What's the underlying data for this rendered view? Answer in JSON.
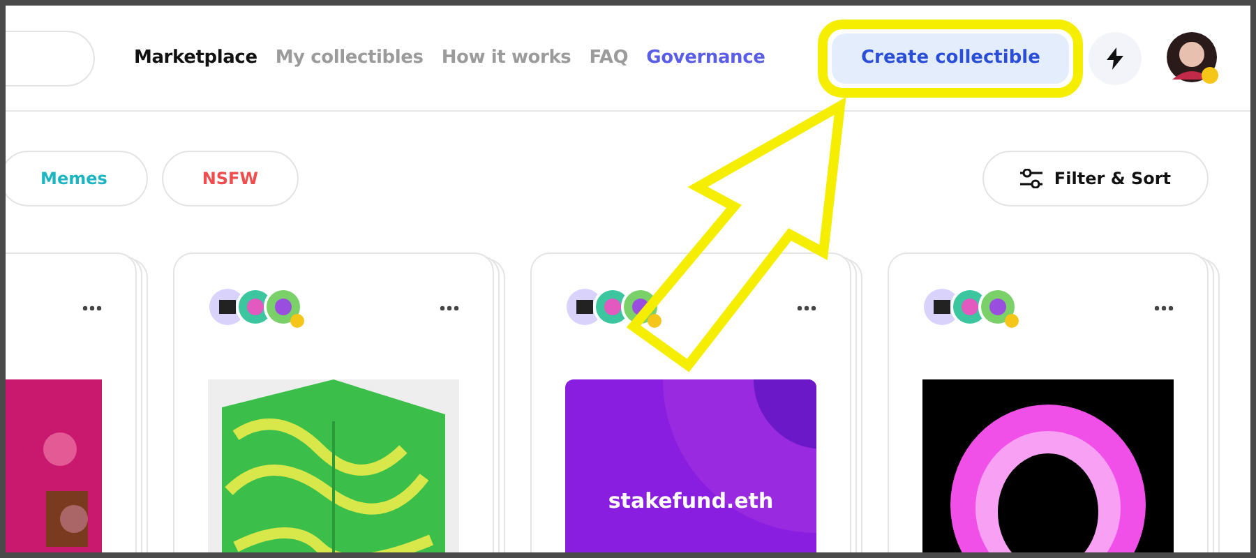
{
  "nav": [
    {
      "label": "Marketplace",
      "selected": true,
      "kind": "plain"
    },
    {
      "label": "My collectibles",
      "selected": false,
      "kind": "plain"
    },
    {
      "label": "How it works",
      "selected": false,
      "kind": "plain"
    },
    {
      "label": "FAQ",
      "selected": false,
      "kind": "plain"
    },
    {
      "label": "Governance",
      "selected": false,
      "kind": "gradient"
    }
  ],
  "create_button": "Create collectible",
  "filters": [
    {
      "label": "Memes",
      "color": "#1cb5c0"
    },
    {
      "label": "NSFW",
      "color": "#f04e4e"
    }
  ],
  "filter_sort": "Filter & Sort",
  "cards": [
    {
      "kind": "figure"
    },
    {
      "kind": "cube"
    },
    {
      "kind": "gradient",
      "caption": "stakefund.eth"
    },
    {
      "kind": "ring"
    }
  ]
}
